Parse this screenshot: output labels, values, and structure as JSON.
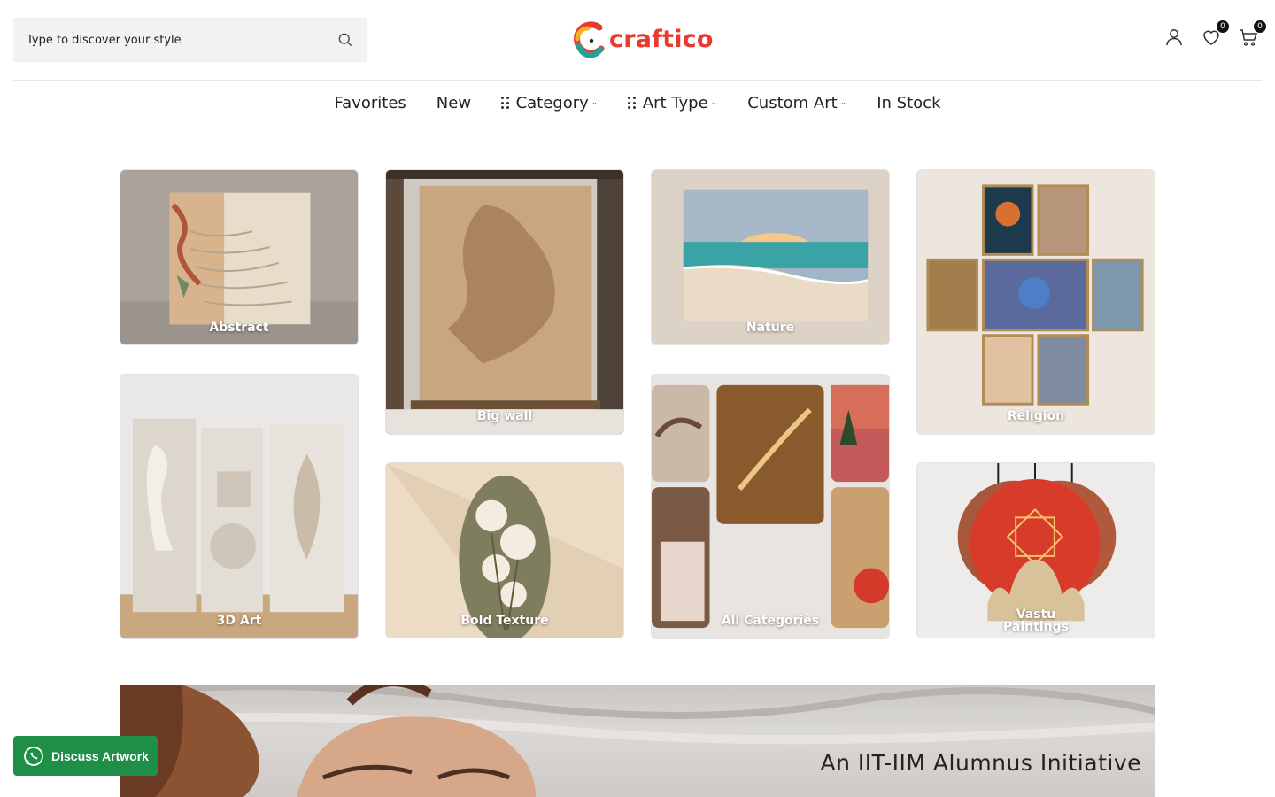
{
  "header": {
    "search_placeholder": "Type to discover your style",
    "logo_text": "craftico",
    "wishlist_count": "0",
    "cart_count": "0"
  },
  "nav": {
    "favorites": "Favorites",
    "new": "New",
    "category": "Category",
    "art_type": "Art Type",
    "custom_art": "Custom Art",
    "in_stock": "In Stock"
  },
  "tiles": {
    "abstract": "Abstract",
    "big_wall": "Big wall",
    "nature": "Nature",
    "religion": "Religion",
    "art_3d": "3D Art",
    "bold_texture": "Bold Texture",
    "all_categories": "All Categories",
    "vastu_line1": "Vastu",
    "vastu_line2": "Paintings"
  },
  "banner": {
    "tagline": "An IIT-IIM Alumnus Initiative"
  },
  "whatsapp": {
    "label": "Discuss Artwork"
  },
  "colors": {
    "brand": "#e63b2e",
    "whatsapp": "#1f8f47"
  }
}
